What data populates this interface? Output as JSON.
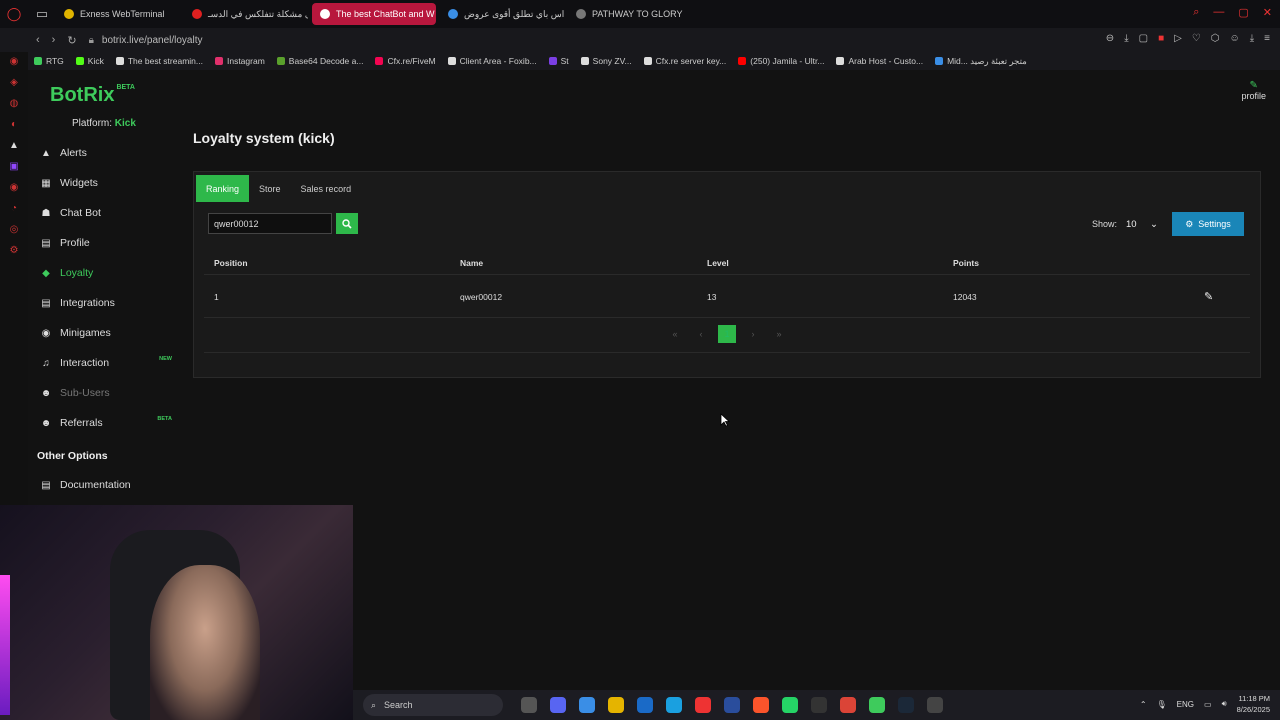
{
  "browser": {
    "tabs": [
      {
        "label": "Exness WebTerminal",
        "color": "#e0b400",
        "active": false
      },
      {
        "label": "حل مشكلة تتفلكس في الدسـ",
        "color": "#e02020",
        "active": false
      },
      {
        "label": "The best ChatBot and W",
        "color": "#ffffff",
        "active": true
      },
      {
        "label": "ميداس باي تطلق أقوى عروض",
        "color": "#3a8ee6",
        "active": false
      },
      {
        "label": "PATHWAY TO GLORY",
        "color": "#777777",
        "active": false
      }
    ],
    "url": "botrix.live/panel/loyalty",
    "bookmarks": [
      {
        "label": "RTG",
        "color": "#3ecb5c"
      },
      {
        "label": "Kick",
        "color": "#53fc18"
      },
      {
        "label": "The best streamin...",
        "color": "#dddddd"
      },
      {
        "label": "Instagram",
        "color": "#e1306c"
      },
      {
        "label": "Base64 Decode a...",
        "color": "#5aa02c"
      },
      {
        "label": "Cfx.re/FiveM",
        "color": "#f40552"
      },
      {
        "label": "Client Area - Foxib...",
        "color": "#dddddd"
      },
      {
        "label": "St",
        "color": "#7b3fe4"
      },
      {
        "label": "Sony ZV...",
        "color": "#dddddd"
      },
      {
        "label": "Cfx.re server key...",
        "color": "#dddddd"
      },
      {
        "label": "(250) Jamila - Ultr...",
        "color": "#ff0000"
      },
      {
        "label": "Arab Host - Custo...",
        "color": "#dddddd"
      },
      {
        "label": "Mid... متجر تعبئة رصيد",
        "color": "#3a8ee6"
      }
    ]
  },
  "app": {
    "logo": "BotRix",
    "logo_badge": "BETA",
    "platform_label": "Platform:",
    "platform_value": "Kick",
    "profile_label": "profile",
    "sidebar": [
      {
        "label": "Alerts",
        "icon": "warning-icon",
        "glyph": "▲",
        "state": ""
      },
      {
        "label": "Widgets",
        "icon": "grid-icon",
        "glyph": "▦",
        "state": ""
      },
      {
        "label": "Chat Bot",
        "icon": "robot-icon",
        "glyph": "☗",
        "state": ""
      },
      {
        "label": "Profile",
        "icon": "id-card-icon",
        "glyph": "▤",
        "state": ""
      },
      {
        "label": "Loyalty",
        "icon": "gem-icon",
        "glyph": "◆",
        "state": "active"
      },
      {
        "label": "Integrations",
        "icon": "list-icon",
        "glyph": "▤",
        "state": ""
      },
      {
        "label": "Minigames",
        "icon": "gamepad-icon",
        "glyph": "◉",
        "state": ""
      },
      {
        "label": "Interaction",
        "icon": "music-icon",
        "glyph": "♫",
        "state": "",
        "badge": "NEW"
      },
      {
        "label": "Sub-Users",
        "icon": "users-icon",
        "glyph": "☻",
        "state": "dim"
      },
      {
        "label": "Referrals",
        "icon": "users-icon",
        "glyph": "☻",
        "state": "",
        "badge": "BETA"
      }
    ],
    "other_options": "Other Options",
    "documentation": "Documentation",
    "page_title": "Loyalty system (kick)",
    "tabs": [
      "Ranking",
      "Store",
      "Sales record"
    ],
    "search_value": "qwer00012",
    "show_label": "Show:",
    "show_value": "10",
    "settings_label": "Settings",
    "table": {
      "headers": [
        "Position",
        "Name",
        "Level",
        "Points"
      ],
      "rows": [
        {
          "position": "1",
          "name": "qwer00012",
          "level": "13",
          "points": "12043"
        }
      ]
    },
    "pagination": {
      "current": "1"
    }
  },
  "taskbar": {
    "search": "Search",
    "lang": "ENG",
    "time": "11:18 PM",
    "date": "8/26/2025"
  }
}
